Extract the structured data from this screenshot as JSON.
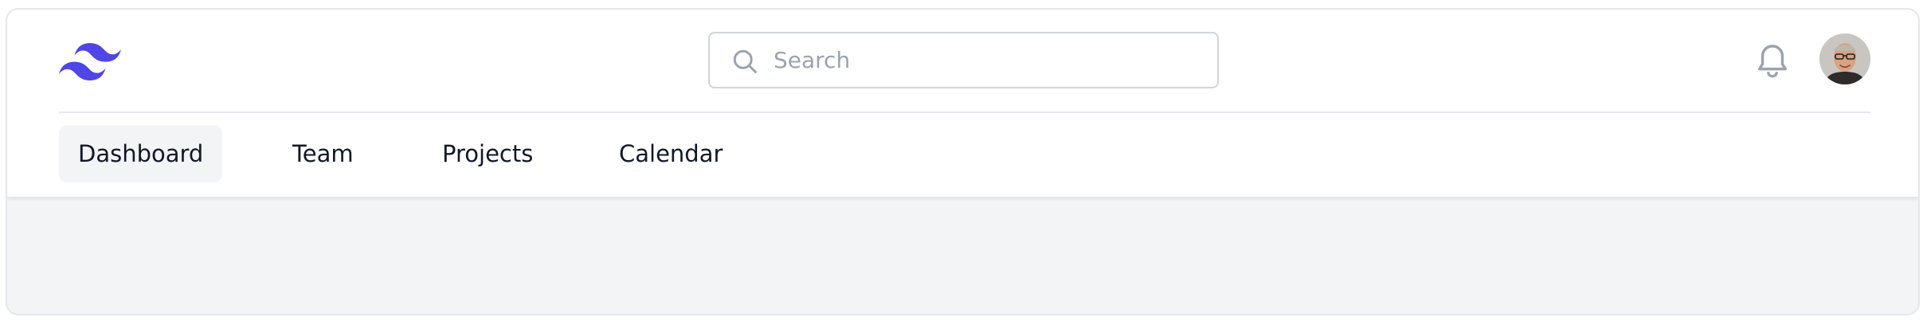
{
  "brand": {
    "logo_icon": "tailwind-wave-logo-icon",
    "accent": "#4f46e5"
  },
  "search": {
    "placeholder": "Search",
    "value": "",
    "icon": "search-icon"
  },
  "header_actions": {
    "notifications_icon": "bell-icon",
    "avatar_icon": "user-avatar"
  },
  "nav": {
    "items": [
      {
        "label": "Dashboard",
        "active": true
      },
      {
        "label": "Team",
        "active": false
      },
      {
        "label": "Projects",
        "active": false
      },
      {
        "label": "Calendar",
        "active": false
      }
    ]
  }
}
